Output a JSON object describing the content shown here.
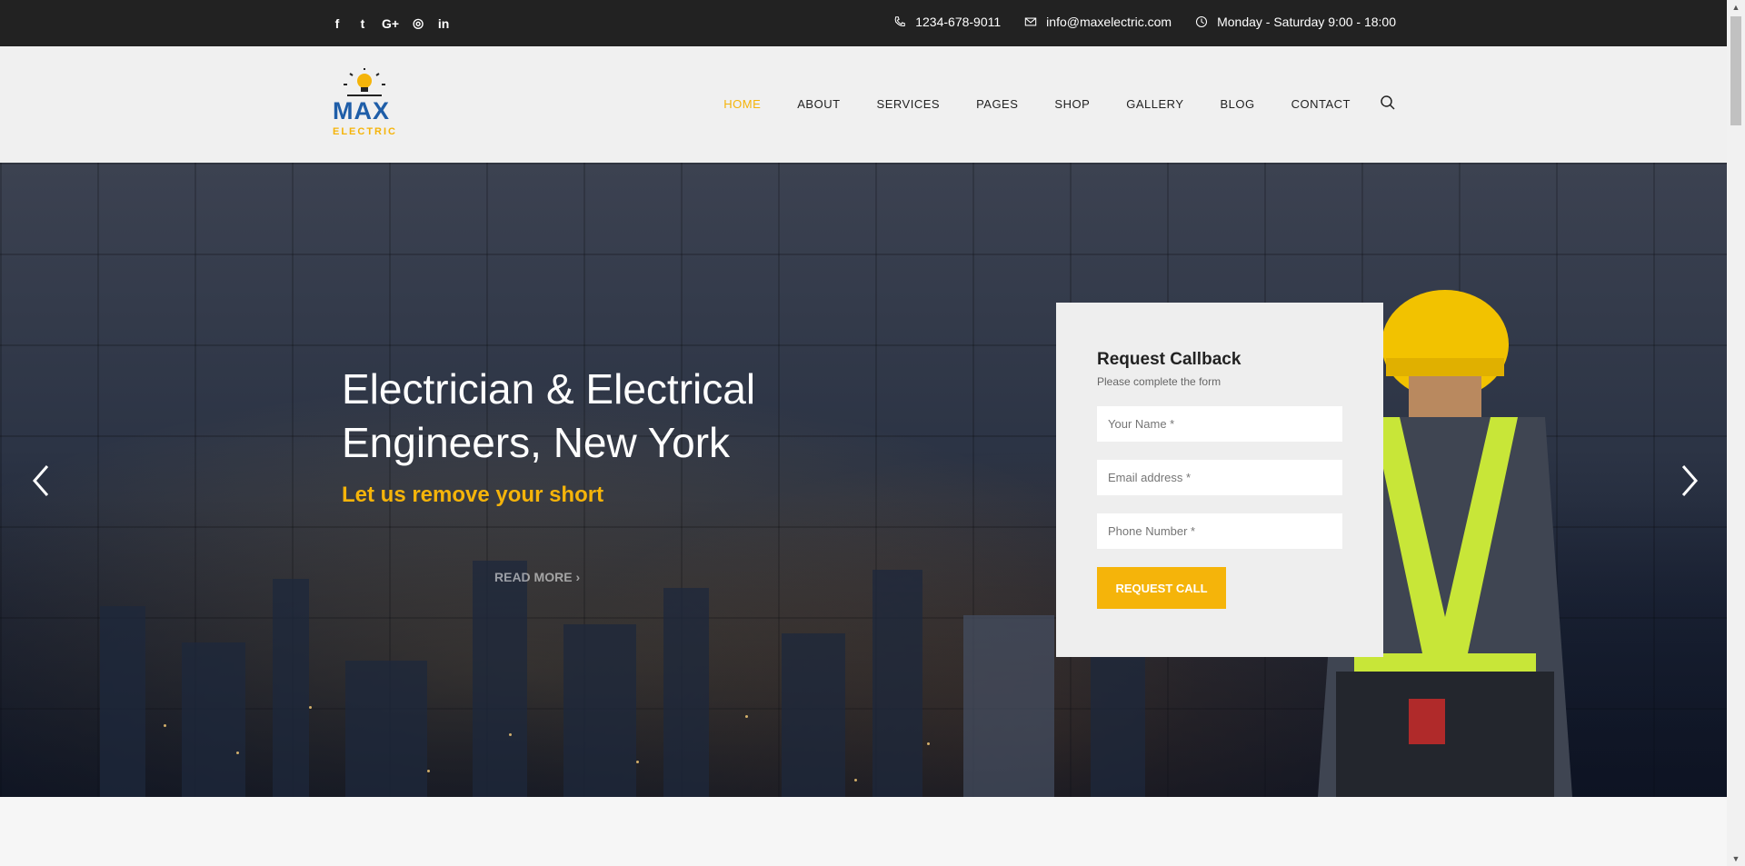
{
  "topbar": {
    "social": [
      {
        "icon": "facebook-icon",
        "glyph": "f"
      },
      {
        "icon": "twitter-icon",
        "glyph": "t"
      },
      {
        "icon": "google-plus-icon",
        "glyph": "G+"
      },
      {
        "icon": "instagram-icon",
        "glyph": "◎"
      },
      {
        "icon": "linkedin-icon",
        "glyph": "in"
      }
    ],
    "phone": "1234-678-9011",
    "email": "info@maxelectric.com",
    "hours": "Monday - Saturday 9:00 - 18:00"
  },
  "logo": {
    "line1": "MAX",
    "line2": "ELECTRIC"
  },
  "nav": {
    "items": [
      "HOME",
      "ABOUT",
      "SERVICES",
      "PAGES",
      "SHOP",
      "GALLERY",
      "BLOG",
      "CONTACT"
    ],
    "active": "HOME"
  },
  "hero": {
    "title": "Electrician & Electrical Engineers, New York",
    "subtitle": "Let us remove your short",
    "read_more": "READ MORE"
  },
  "form": {
    "title": "Request Callback",
    "subtitle": "Please complete the form",
    "name_placeholder": "Your Name *",
    "email_placeholder": "Email address *",
    "phone_placeholder": "Phone Number *",
    "button": "REQUEST CALL"
  },
  "colors": {
    "accent": "#f5b40a",
    "brand": "#1f5ea8",
    "topbar": "#222222"
  }
}
